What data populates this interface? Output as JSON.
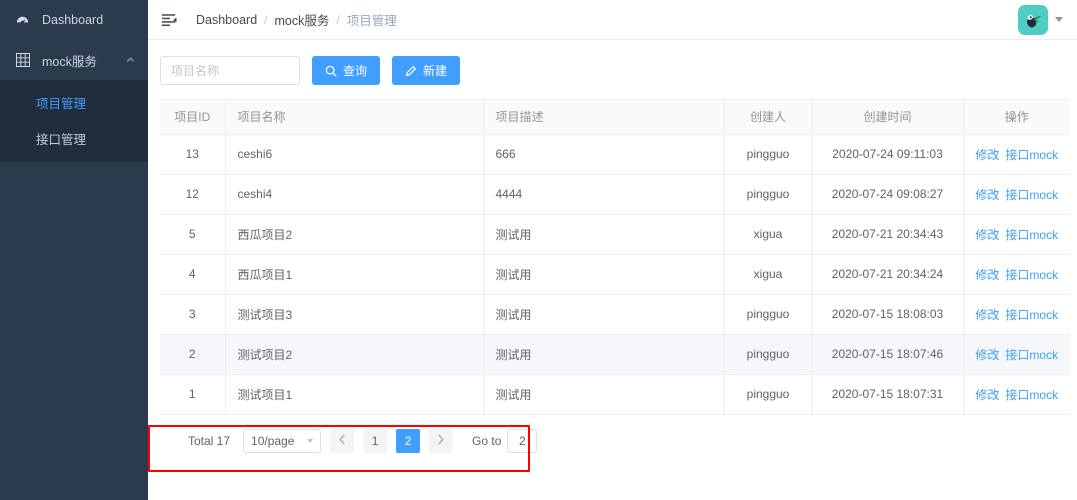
{
  "sidebar": {
    "items": [
      {
        "label": "Dashboard",
        "icon": "dashboard-icon",
        "active": false
      },
      {
        "label": "mock服务",
        "icon": "grid-icon",
        "active": false,
        "expanded": true
      }
    ],
    "submenu": [
      {
        "label": "项目管理",
        "active": true
      },
      {
        "label": "接口管理",
        "active": false
      }
    ],
    "bg_color": "#2c3a4e",
    "submenu_bg_color": "#1f2d3d",
    "active_color": "#409eff"
  },
  "topbar": {
    "fold_icon": "menu-fold-icon",
    "breadcrumb": [
      "Dashboard",
      "mock服务",
      "项目管理"
    ],
    "separator": "/",
    "avatar_icon": "user-avatar",
    "avatar_bg": "#4ecdc4",
    "caret_icon": "caret-down-icon"
  },
  "toolbar": {
    "search_placeholder": "项目名称",
    "search_value": "",
    "query_label": "查询",
    "query_icon": "search-icon",
    "create_label": "新建",
    "create_icon": "edit-pencil-icon",
    "button_color": "#409eff"
  },
  "table": {
    "columns": [
      "项目ID",
      "项目名称",
      "项目描述",
      "创建人",
      "创建时间",
      "操作"
    ],
    "rows": [
      {
        "id": "13",
        "name": "ceshi6",
        "desc": "666",
        "creator": "pingguo",
        "created": "2020-07-24 09:11:03",
        "hovered": false
      },
      {
        "id": "12",
        "name": "ceshi4",
        "desc": "4444",
        "creator": "pingguo",
        "created": "2020-07-24 09:08:27",
        "hovered": false
      },
      {
        "id": "5",
        "name": "西瓜项目2",
        "desc": "测试用",
        "creator": "xigua",
        "created": "2020-07-21 20:34:43",
        "hovered": false
      },
      {
        "id": "4",
        "name": "西瓜项目1",
        "desc": "测试用",
        "creator": "xigua",
        "created": "2020-07-21 20:34:24",
        "hovered": false
      },
      {
        "id": "3",
        "name": "测试项目3",
        "desc": "测试用",
        "creator": "pingguo",
        "created": "2020-07-15 18:08:03",
        "hovered": false
      },
      {
        "id": "2",
        "name": "测试项目2",
        "desc": "测试用",
        "creator": "pingguo",
        "created": "2020-07-15 18:07:46",
        "hovered": true
      },
      {
        "id": "1",
        "name": "测试项目1",
        "desc": "测试用",
        "creator": "pingguo",
        "created": "2020-07-15 18:07:31",
        "hovered": false
      }
    ],
    "actions": {
      "edit": "修改",
      "mock": "接口mock"
    }
  },
  "pagination": {
    "total_label": "Total 17",
    "page_size": "10/page",
    "prev_icon": "chevron-left-icon",
    "next_icon": "chevron-right-icon",
    "pages": [
      {
        "label": "1",
        "active": false
      },
      {
        "label": "2",
        "active": true
      }
    ],
    "jump_label": "Go to",
    "jump_value": "2",
    "active_color": "#409eff"
  },
  "annotation": {
    "color": "#ff0000"
  }
}
